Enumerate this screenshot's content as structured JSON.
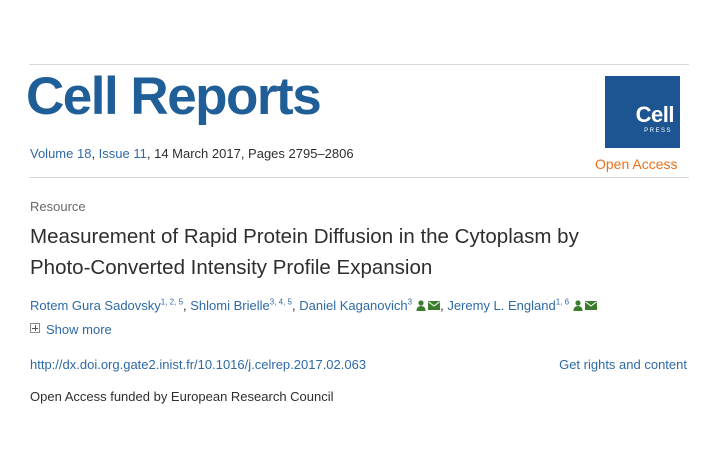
{
  "header": {
    "journal_title": "Cell Reports",
    "volume": "Volume 18",
    "issue": "Issue 11",
    "date_pages": "14 March 2017, Pages 2795–2806",
    "logo_text": "Cell",
    "logo_sub": "PRESS",
    "open_access": "Open Access"
  },
  "article": {
    "section": "Resource",
    "title_line1": "Measurement of Rapid Protein Diffusion in the Cytoplasm by",
    "title_line2": "Photo-Converted Intensity Profile Expansion",
    "authors": [
      {
        "name": "Rotem Gura Sadovsky",
        "sup": "1, 2, 5"
      },
      {
        "name": "Shlomi Brielle",
        "sup": "3, 4, 5"
      },
      {
        "name": "Daniel Kaganovich",
        "sup": "3"
      },
      {
        "name": "Jeremy L. England",
        "sup": "1, 6"
      }
    ],
    "show_more": "Show more",
    "doi_link": "http://dx.doi.org.gate2.inist.fr/10.1016/j.celrep.2017.02.063",
    "rights_link": "Get rights and content",
    "funding": "Open Access funded by European Research Council"
  },
  "colors": {
    "brand_blue": "#1f5e96",
    "link_blue": "#2e6aa6",
    "open_access_orange": "#e9711c",
    "icon_green": "#3a7d2c"
  },
  "icons": [
    "person-icon",
    "mail-icon",
    "plus-box-icon"
  ]
}
